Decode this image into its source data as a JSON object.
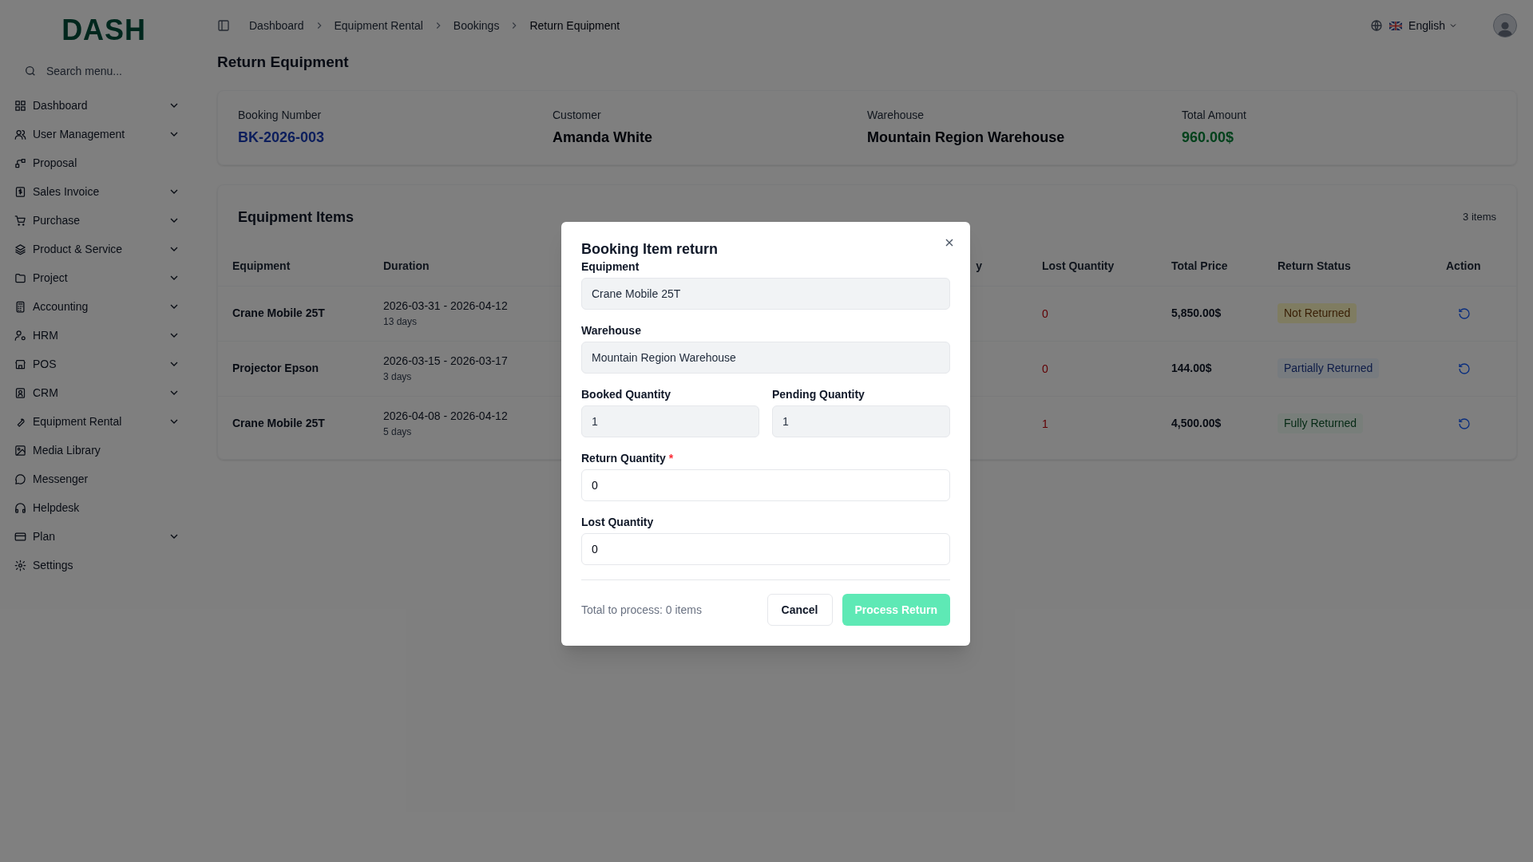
{
  "sidebar": {
    "logo": "DASH",
    "search": {
      "placeholder": "Search menu..."
    },
    "items": [
      {
        "label": "Dashboard",
        "expandable": true
      },
      {
        "label": "User Management",
        "expandable": true
      },
      {
        "label": "Proposal",
        "expandable": false
      },
      {
        "label": "Sales Invoice",
        "expandable": true
      },
      {
        "label": "Purchase",
        "expandable": true
      },
      {
        "label": "Product & Service",
        "expandable": true
      },
      {
        "label": "Project",
        "expandable": true
      },
      {
        "label": "Accounting",
        "expandable": true
      },
      {
        "label": "HRM",
        "expandable": true
      },
      {
        "label": "POS",
        "expandable": true
      },
      {
        "label": "CRM",
        "expandable": true
      },
      {
        "label": "Equipment Rental",
        "expandable": true
      },
      {
        "label": "Media Library",
        "expandable": false
      },
      {
        "label": "Messenger",
        "expandable": false
      },
      {
        "label": "Helpdesk",
        "expandable": false
      },
      {
        "label": "Plan",
        "expandable": true
      },
      {
        "label": "Settings",
        "expandable": false
      }
    ]
  },
  "breadcrumb": [
    "Dashboard",
    "Equipment Rental",
    "Bookings",
    "Return Equipment"
  ],
  "language": "English",
  "page_title": "Return Equipment",
  "summary": [
    {
      "label": "Booking Number",
      "value": "BK-2026-003",
      "kind": "link"
    },
    {
      "label": "Customer",
      "value": "Amanda White",
      "kind": "plain"
    },
    {
      "label": "Warehouse",
      "value": "Mountain Region Warehouse",
      "kind": "plain"
    },
    {
      "label": "Total Amount",
      "value": "960.00$",
      "kind": "money"
    }
  ],
  "equipment_items": {
    "title": "Equipment Items",
    "count": "3 items",
    "columns": [
      "Equipment",
      "Duration",
      "y",
      "Lost Quantity",
      "Total Price",
      "Return Status",
      "Action"
    ],
    "rows": [
      {
        "equipment": "Crane Mobile 25T",
        "dates": "2026-03-31 - 2026-04-12",
        "days": "13 days",
        "lost_quantity": "0",
        "total_price": "5,850.00$",
        "status": "Not Returned",
        "kind": "not_returned"
      },
      {
        "equipment": "Projector Epson",
        "dates": "2026-03-15 - 2026-03-17",
        "days": "3 days",
        "lost_quantity": "0",
        "total_price": "144.00$",
        "status": "Partially Returned",
        "kind": "partial"
      },
      {
        "equipment": "Crane Mobile 25T",
        "dates": "2026-04-08 - 2026-04-12",
        "days": "5 days",
        "lost_quantity": "1",
        "total_price": "4,500.00$",
        "status": "Fully Returned",
        "kind": "full"
      }
    ]
  },
  "dialog": {
    "title": "Booking Item return",
    "fields": [
      {
        "label": "Equipment",
        "value": "Crane Mobile 25T",
        "readonly": true,
        "required": false,
        "half": false
      },
      {
        "label": "Warehouse",
        "value": "Mountain Region Warehouse",
        "readonly": true,
        "required": false,
        "half": false
      },
      {
        "label": "Booked Quantity",
        "value": "1",
        "readonly": true,
        "required": false,
        "half": true
      },
      {
        "label": "Pending Quantity",
        "value": "1",
        "readonly": true,
        "required": false,
        "half": true
      },
      {
        "label": "Return Quantity",
        "value": "0",
        "readonly": false,
        "required": true,
        "required_mark": "*",
        "half": false
      },
      {
        "label": "Lost Quantity",
        "value": "0",
        "readonly": false,
        "required": false,
        "half": false
      }
    ],
    "total_text": "Total to process: 0 items",
    "cancel": "Cancel",
    "submit": {
      "label": "Process Return",
      "disabled": true
    }
  }
}
